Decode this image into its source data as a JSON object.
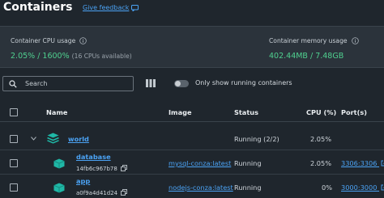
{
  "page": {
    "title": "Containers",
    "feedback": "Give feedback"
  },
  "stats": {
    "cpu_label": "Container CPU usage",
    "cpu_value": "2.05% / 1600%",
    "cpu_sub": "(16 CPUs available)",
    "mem_label": "Container memory usage",
    "mem_value": "402.44MB / 7.48GB"
  },
  "toolbar": {
    "search_placeholder": "Search",
    "toggle_label": "Only show running containers",
    "toggle_on": false
  },
  "table": {
    "headers": {
      "name": "Name",
      "image": "Image",
      "status": "Status",
      "cpu": "CPU (%)",
      "ports": "Port(s)"
    },
    "group": {
      "name": "world",
      "status": "Running (2/2)",
      "cpu": "2.05%"
    },
    "rows": [
      {
        "name": "database",
        "id": "14fb6c967b78",
        "image": "mysql-conza:latest",
        "status": "Running",
        "cpu": "2.05%",
        "port": "3306:3306"
      },
      {
        "name": "app",
        "id": "a0f9a4d41d24",
        "image": "nodejs-conza:latest",
        "status": "Running",
        "cpu": "0%",
        "port": "3000:3000"
      }
    ]
  },
  "colors": {
    "accent": "#4ba3f5",
    "usage": "#4fd08f",
    "container_icon": "#1fb7a6"
  }
}
